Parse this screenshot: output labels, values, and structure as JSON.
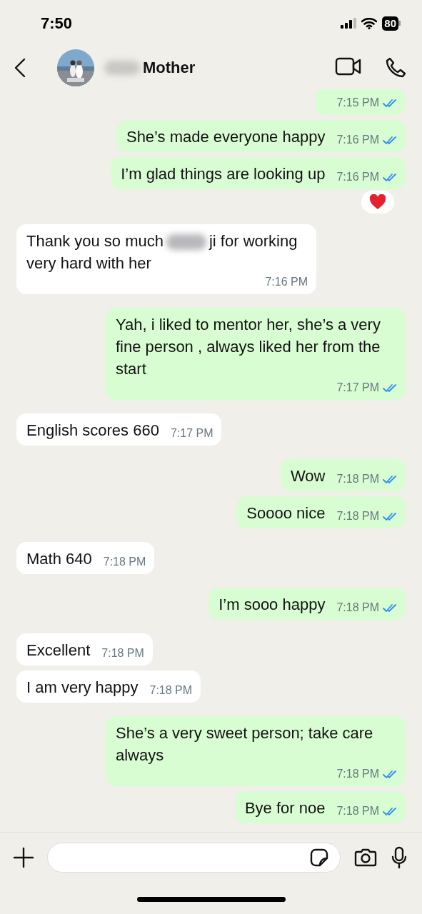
{
  "status_bar": {
    "time": "7:50",
    "battery": "80"
  },
  "header": {
    "name": "Mother",
    "name_redacted": true
  },
  "messages": [
    {
      "kind": "out",
      "time": "7:15 PM",
      "read": true
    },
    {
      "kind": "out",
      "text": "She’s made everyone happy",
      "time": "7:16 PM",
      "read": true
    },
    {
      "kind": "out",
      "text": "I’m glad things are looking up",
      "time": "7:16 PM",
      "read": true,
      "reacted": true
    },
    {
      "kind": "in",
      "text": "Thank you so much",
      "redacted": true,
      "text_after": "ji for working very hard with her",
      "time": "7:16 PM"
    },
    {
      "kind": "out",
      "text": "Yah, i liked to mentor her, she’s a very fine person , always liked her from the start",
      "time": "7:17 PM",
      "read": true
    },
    {
      "kind": "in",
      "text": "English scores 660",
      "time": "7:17 PM"
    },
    {
      "kind": "out",
      "text": "Wow",
      "time": "7:18 PM",
      "read": true
    },
    {
      "kind": "out",
      "text": "Soooo nice",
      "time": "7:18 PM",
      "read": true
    },
    {
      "kind": "in",
      "text": "Math 640",
      "time": "7:18 PM"
    },
    {
      "kind": "out",
      "text": "I’m sooo happy",
      "time": "7:18 PM",
      "read": true
    },
    {
      "kind": "in",
      "text": "Excellent",
      "time": "7:18 PM"
    },
    {
      "kind": "in",
      "text": "I am very happy",
      "time": "7:18 PM"
    },
    {
      "kind": "out",
      "text": "She’s a very sweet person; take care always",
      "time": "7:18 PM",
      "read": true
    },
    {
      "kind": "out",
      "text": "Bye for noe",
      "time": "7:18 PM",
      "read": true
    }
  ]
}
